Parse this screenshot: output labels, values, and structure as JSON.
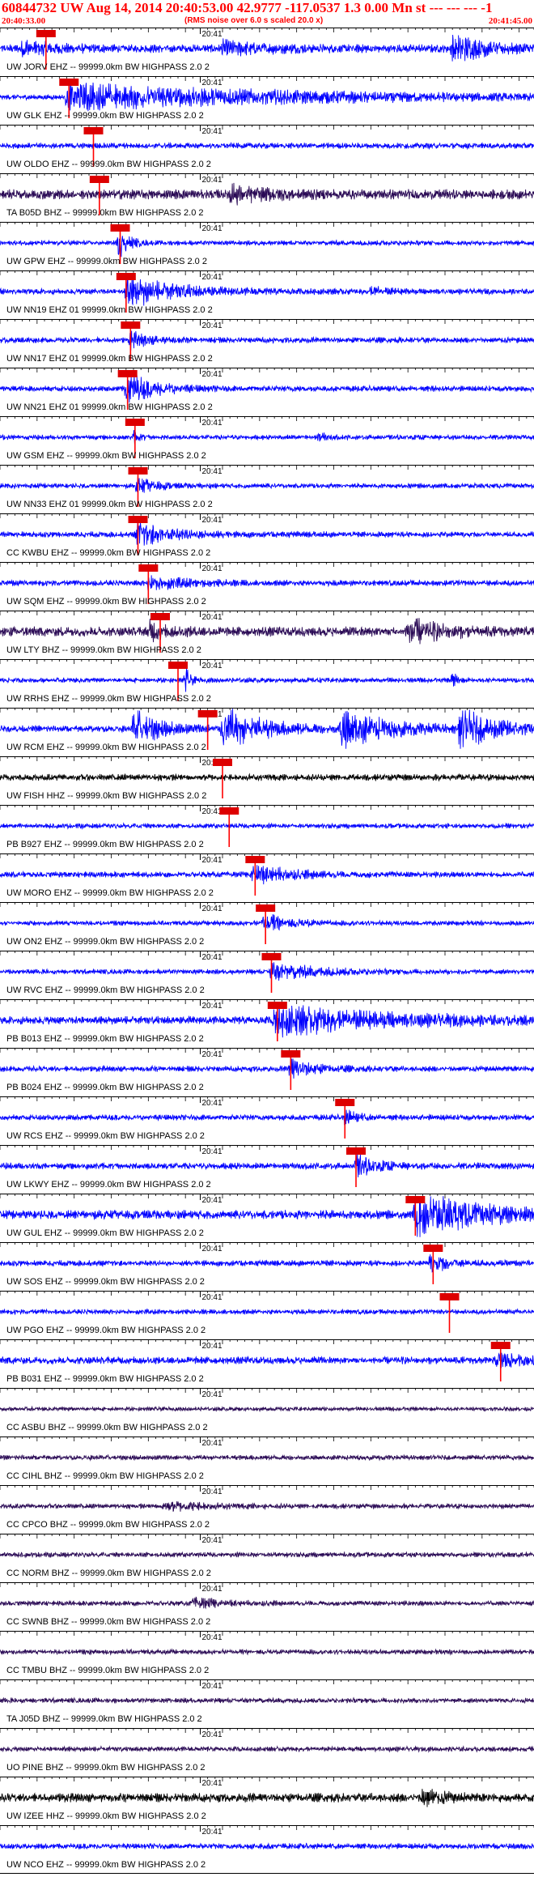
{
  "header": {
    "title": "60844732  UW Aug 14, 2014 20:40:53.00    42.9777  -117.0537   1.3  0.00  Mn st --- --- ---   -1",
    "subtitle": "(RMS noise over 6.0 s scaled 20.0 x)",
    "time_start": "20:40:33.00",
    "time_end": "20:41:45.00"
  },
  "colors": {
    "header_text": "#ff0000",
    "pick_box": "#dd0000",
    "pick_line": "#ff0000",
    "trace_blue": "#0000ff",
    "trace_dark": "#2a0a55",
    "trace_black": "#000000"
  },
  "chart_data": {
    "type": "line",
    "x_range_seconds": [
      0,
      72
    ],
    "center_tick_label": "20:41",
    "traces": [
      {
        "name": "UW JORV EHZ -- 99999.0km BW  HIGHPASS  2.0  2",
        "color": "blue",
        "pick": 6.2,
        "amp": 0.5,
        "bursts": [
          [
            3,
            8,
            0.9
          ],
          [
            30,
            12,
            0.7
          ],
          [
            61,
            11,
            1.4
          ]
        ]
      },
      {
        "name": "UW GLK EHZ -- 99999.0km BW  HIGHPASS  2.0  2",
        "color": "blue",
        "pick": 9.3,
        "amp": 0.3,
        "bursts": [
          [
            9,
            60,
            1.7
          ]
        ]
      },
      {
        "name": "UW OLDO EHZ -- 99999.0km BW  HIGHPASS  2.0  2",
        "color": "blue",
        "pick": 12.6,
        "amp": 0.35,
        "bursts": []
      },
      {
        "name": "TA B05D BHZ -- 99999.0km BW  HIGHPASS  2.0  2",
        "color": "dark",
        "pick": 13.4,
        "amp": 0.6,
        "bursts": [
          [
            31,
            10,
            0.9
          ]
        ]
      },
      {
        "name": "UW GPW EHZ -- 99999.0km BW  HIGHPASS  2.0  2",
        "color": "blue",
        "pick": 16.2,
        "amp": 0.3,
        "bursts": [
          [
            16,
            2.5,
            2.0
          ]
        ]
      },
      {
        "name": "UW NN19 EHZ 01 99999.0km BW  HIGHPASS  2.0  2",
        "color": "blue",
        "pick": 17.0,
        "amp": 0.35,
        "bursts": [
          [
            17,
            13,
            1.9
          ],
          [
            50,
            4,
            0.5
          ]
        ]
      },
      {
        "name": "UW NN17 EHZ 01 99999.0km BW  HIGHPASS  2.0  2",
        "color": "blue",
        "pick": 17.6,
        "amp": 0.35,
        "bursts": [
          [
            17.6,
            5,
            1.0
          ]
        ]
      },
      {
        "name": "UW NN21 EHZ 01 99999.0km BW  HIGHPASS  2.0  2",
        "color": "blue",
        "pick": 17.2,
        "amp": 0.35,
        "bursts": [
          [
            17,
            7,
            1.9
          ]
        ]
      },
      {
        "name": "UW GSM EHZ -- 99999.0km BW  HIGHPASS  2.0  2",
        "color": "blue",
        "pick": 18.2,
        "amp": 0.3,
        "bursts": [
          [
            18,
            2,
            0.6
          ],
          [
            43,
            2,
            0.5
          ]
        ]
      },
      {
        "name": "UW NN33 EHZ 01 99999.0km BW  HIGHPASS  2.0  2",
        "color": "blue",
        "pick": 18.6,
        "amp": 0.3,
        "bursts": [
          [
            18.5,
            5,
            0.9
          ]
        ]
      },
      {
        "name": "CC KWBU EHZ -- 99999.0km BW  HIGHPASS  2.0  2",
        "color": "blue",
        "pick": 18.6,
        "amp": 0.35,
        "bursts": [
          [
            18.5,
            9,
            1.6
          ]
        ]
      },
      {
        "name": "UW SQM EHZ -- 99999.0km BW  HIGHPASS  2.0  2",
        "color": "blue",
        "pick": 20.0,
        "amp": 0.35,
        "bursts": [
          [
            20,
            10,
            0.8
          ]
        ]
      },
      {
        "name": "UW LTY BHZ -- 99999.0km BW  HIGHPASS  2.0  2",
        "color": "dark",
        "pick": 21.6,
        "amp": 0.6,
        "bursts": [
          [
            20,
            4,
            1.0
          ],
          [
            55,
            8,
            1.5
          ]
        ]
      },
      {
        "name": "UW RRHS EHZ -- 99999.0km BW  HIGHPASS  2.0  2",
        "color": "blue",
        "pick": 24.0,
        "amp": 0.3,
        "bursts": [
          [
            25,
            1.2,
            1.6
          ],
          [
            61,
            1,
            1.2
          ]
        ]
      },
      {
        "name": "UW RCM EHZ -- 99999.0km BW  HIGHPASS  2.0  2",
        "color": "blue",
        "pick": 28.0,
        "amp": 0.4,
        "bursts": [
          [
            18,
            7,
            2.2
          ],
          [
            30,
            11,
            2.4
          ],
          [
            46,
            12,
            2.4
          ],
          [
            62,
            10,
            2.2
          ]
        ]
      },
      {
        "name": "UW FISH HHZ -- 99999.0km BW  HIGHPASS  2.0  2",
        "color": "black",
        "pick": 30.0,
        "amp": 0.4,
        "bursts": []
      },
      {
        "name": "PB B927 EHZ -- 99999.0km BW  HIGHPASS  2.0  2",
        "color": "blue",
        "pick": 30.9,
        "amp": 0.3,
        "bursts": []
      },
      {
        "name": "UW MORO EHZ -- 99999.0km BW  HIGHPASS  2.0  2",
        "color": "blue",
        "pick": 34.4,
        "amp": 0.35,
        "bursts": [
          [
            34,
            10,
            1.2
          ]
        ]
      },
      {
        "name": "UW ON2 EHZ -- 99999.0km BW  HIGHPASS  2.0  2",
        "color": "blue",
        "pick": 35.8,
        "amp": 0.3,
        "bursts": [
          [
            35.5,
            6,
            1.3
          ]
        ]
      },
      {
        "name": "UW RVC EHZ -- 99999.0km BW  HIGHPASS  2.0  2",
        "color": "blue",
        "pick": 36.6,
        "amp": 0.3,
        "bursts": [
          [
            36.5,
            12,
            1.1
          ]
        ]
      },
      {
        "name": "PB B013 EHZ -- 99999.0km BW  HIGHPASS  2.0  2",
        "color": "blue",
        "pick": 37.4,
        "amp": 0.5,
        "bursts": [
          [
            37,
            30,
            1.7
          ]
        ]
      },
      {
        "name": "PB B024 EHZ -- 99999.0km BW  HIGHPASS  2.0  2",
        "color": "blue",
        "pick": 39.2,
        "amp": 0.35,
        "bursts": [
          [
            39,
            6,
            1.3
          ]
        ]
      },
      {
        "name": "UW RCS EHZ -- 99999.0km BW  HIGHPASS  2.0  2",
        "color": "blue",
        "pick": 46.5,
        "amp": 0.35,
        "bursts": [
          [
            46.5,
            3,
            0.9
          ]
        ]
      },
      {
        "name": "UW LKWY EHZ -- 99999.0km BW  HIGHPASS  2.0  2",
        "color": "blue",
        "pick": 48.0,
        "amp": 0.4,
        "bursts": [
          [
            48,
            5,
            1.3
          ]
        ]
      },
      {
        "name": "UW GUL EHZ -- 99999.0km BW  HIGHPASS  2.0  2",
        "color": "blue",
        "pick": 56.0,
        "amp": 0.55,
        "bursts": [
          [
            56,
            18,
            2.4
          ]
        ]
      },
      {
        "name": "UW SOS EHZ -- 99999.0km BW  HIGHPASS  2.0  2",
        "color": "blue",
        "pick": 58.4,
        "amp": 0.35,
        "bursts": [
          [
            58,
            5,
            1.2
          ]
        ]
      },
      {
        "name": "UW PGO EHZ -- 99999.0km BW  HIGHPASS  2.0  2",
        "color": "blue",
        "pick": 60.6,
        "amp": 0.3,
        "bursts": []
      },
      {
        "name": "PB B031 EHZ -- 99999.0km BW  HIGHPASS  2.0  2",
        "color": "blue",
        "pick": 67.5,
        "amp": 0.45,
        "bursts": [
          [
            67,
            5,
            1.0
          ]
        ]
      },
      {
        "name": "CC ASBU BHZ -- 99999.0km BW  HIGHPASS  2.0  2",
        "color": "dark",
        "pick": null,
        "amp": 0.25,
        "bursts": []
      },
      {
        "name": "CC CIHL BHZ -- 99999.0km BW  HIGHPASS  2.0  2",
        "color": "dark",
        "pick": null,
        "amp": 0.3,
        "bursts": []
      },
      {
        "name": "CC CPCO BHZ -- 99999.0km BW  HIGHPASS  2.0  2",
        "color": "dark",
        "pick": null,
        "amp": 0.3,
        "bursts": [
          [
            22,
            10,
            0.6
          ]
        ]
      },
      {
        "name": "CC NORM BHZ -- 99999.0km BW  HIGHPASS  2.0  2",
        "color": "dark",
        "pick": null,
        "amp": 0.3,
        "bursts": []
      },
      {
        "name": "CC SWNB BHZ -- 99999.0km BW  HIGHPASS  2.0  2",
        "color": "dark",
        "pick": null,
        "amp": 0.3,
        "bursts": [
          [
            26,
            8,
            0.6
          ]
        ]
      },
      {
        "name": "CC TMBU BHZ -- 99999.0km BW  HIGHPASS  2.0  2",
        "color": "dark",
        "pick": null,
        "amp": 0.3,
        "bursts": []
      },
      {
        "name": "TA J05D BHZ -- 99999.0km BW  HIGHPASS  2.0  2",
        "color": "dark",
        "pick": null,
        "amp": 0.3,
        "bursts": []
      },
      {
        "name": "UO PINE BHZ -- 99999.0km BW  HIGHPASS  2.0  2",
        "color": "dark",
        "pick": null,
        "amp": 0.3,
        "bursts": []
      },
      {
        "name": "UW IZEE HHZ -- 99999.0km BW  HIGHPASS  2.0  2",
        "color": "black",
        "pick": null,
        "amp": 0.55,
        "bursts": [
          [
            57,
            5,
            1.0
          ]
        ]
      },
      {
        "name": "UW NCO EHZ -- 99999.0km BW  HIGHPASS  2.0  2",
        "color": "blue",
        "pick": null,
        "amp": 0.35,
        "bursts": []
      }
    ]
  }
}
